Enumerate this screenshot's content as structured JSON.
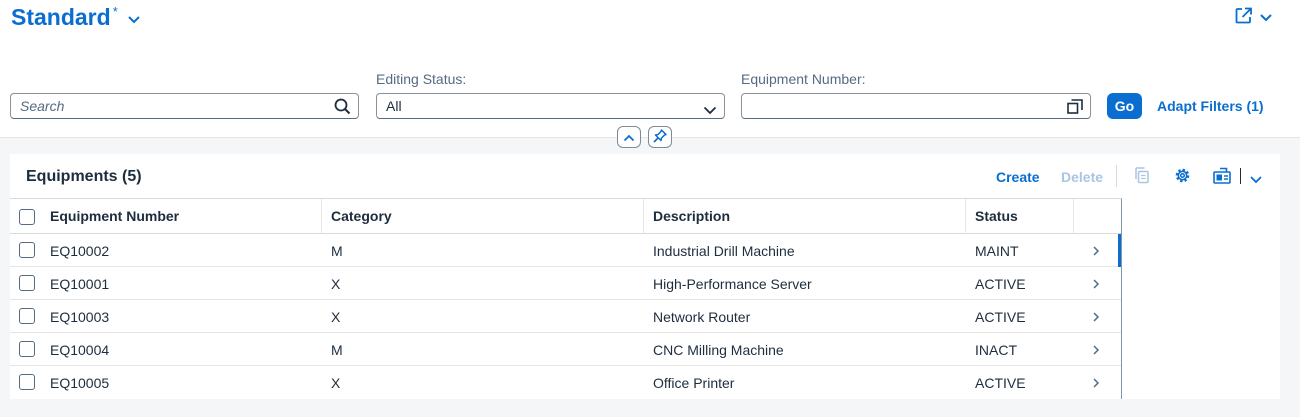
{
  "variant": {
    "title": "Standard",
    "modified_mark": "*"
  },
  "filters": {
    "search": {
      "placeholder": "Search"
    },
    "editing_status": {
      "label": "Editing Status:",
      "value": "All"
    },
    "equipment_number": {
      "label": "Equipment Number:",
      "value": ""
    },
    "go_label": "Go",
    "adapt_label": "Adapt Filters (1)"
  },
  "table": {
    "title": "Equipments (5)",
    "toolbar": {
      "create_label": "Create",
      "delete_label": "Delete"
    },
    "columns": [
      "Equipment Number",
      "Category",
      "Description",
      "Status"
    ],
    "rows": [
      {
        "number": "EQ10002",
        "category": "M",
        "description": "Industrial Drill Machine",
        "status": "MAINT",
        "selected": true
      },
      {
        "number": "EQ10001",
        "category": "X",
        "description": "High-Performance Server",
        "status": "ACTIVE",
        "selected": false
      },
      {
        "number": "EQ10003",
        "category": "X",
        "description": "Network Router",
        "status": "ACTIVE",
        "selected": false
      },
      {
        "number": "EQ10004",
        "category": "M",
        "description": "CNC Milling Machine",
        "status": "INACT",
        "selected": false
      },
      {
        "number": "EQ10005",
        "category": "X",
        "description": "Office Printer",
        "status": "ACTIVE",
        "selected": false
      }
    ]
  },
  "colors": {
    "accent": "#0a6ed1",
    "text": "#1d2d3e",
    "muted": "#556b82",
    "disabled": "#a9c5e4",
    "background": "#f5f6f7"
  },
  "icons": [
    "chevron-down-icon",
    "share-icon",
    "search-icon",
    "value-help-icon",
    "collapse-icon",
    "pin-icon",
    "copy-icon",
    "settings-icon",
    "export-icon",
    "chevron-right-icon"
  ]
}
